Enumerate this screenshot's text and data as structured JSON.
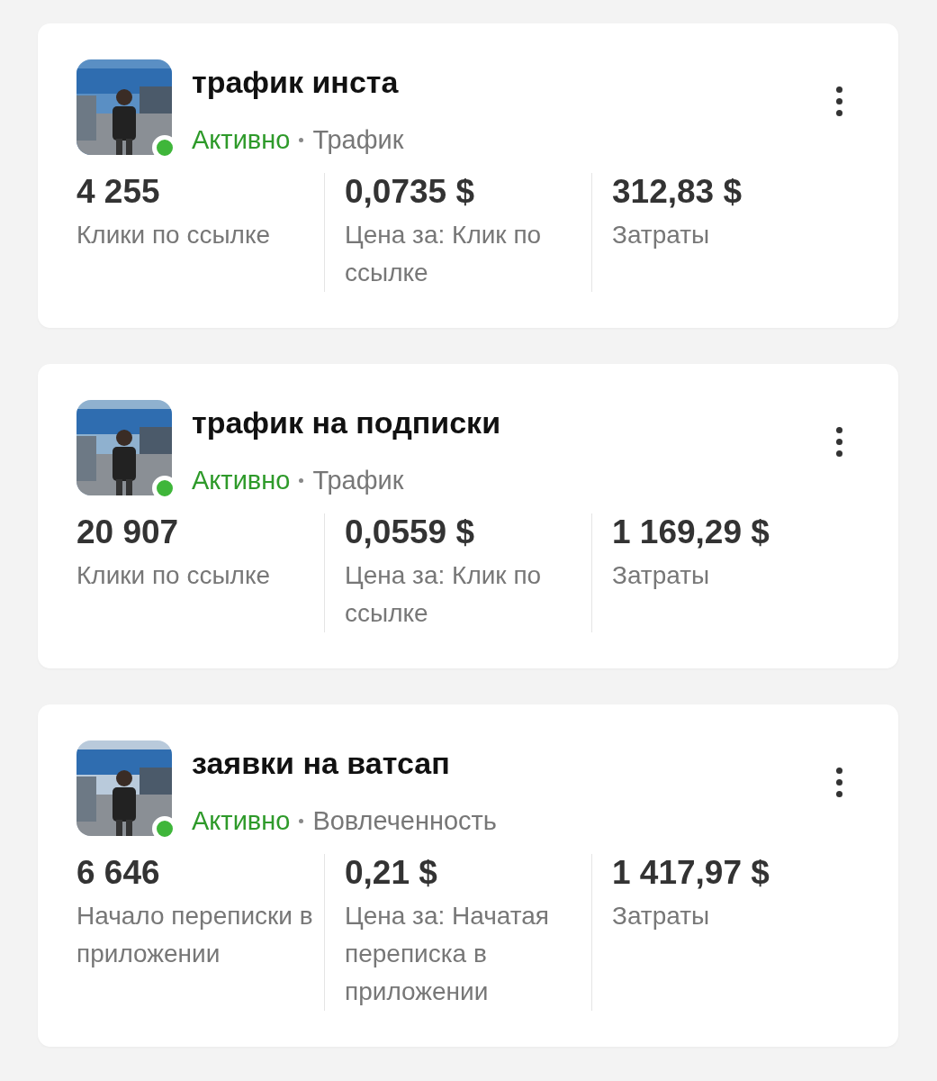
{
  "campaigns": [
    {
      "title": "трафик инста",
      "status": "Активно",
      "active": true,
      "objective": "Трафик",
      "metrics": [
        {
          "value": "4 255",
          "label": "Клики по ссылке"
        },
        {
          "value": "0,0735 $",
          "label": "Цена за: Клик по ссылке"
        },
        {
          "value": "312,83 $",
          "label": "Затраты"
        }
      ]
    },
    {
      "title": "трафик на подписки",
      "status": "Активно",
      "active": true,
      "objective": "Трафик",
      "metrics": [
        {
          "value": "20 907",
          "label": "Клики по ссылке"
        },
        {
          "value": "0,0559 $",
          "label": "Цена за: Клик по ссылке"
        },
        {
          "value": "1 169,29 $",
          "label": "Затраты"
        }
      ]
    },
    {
      "title": "заявки на ватсап",
      "status": "Активно",
      "active": true,
      "objective": "Вовлеченность",
      "metrics": [
        {
          "value": "6 646",
          "label": "Начало переписки в приложении"
        },
        {
          "value": "0,21 $",
          "label": "Цена за: Начатая переписка в приложении"
        },
        {
          "value": "1 417,97 $",
          "label": "Затраты"
        }
      ]
    }
  ]
}
